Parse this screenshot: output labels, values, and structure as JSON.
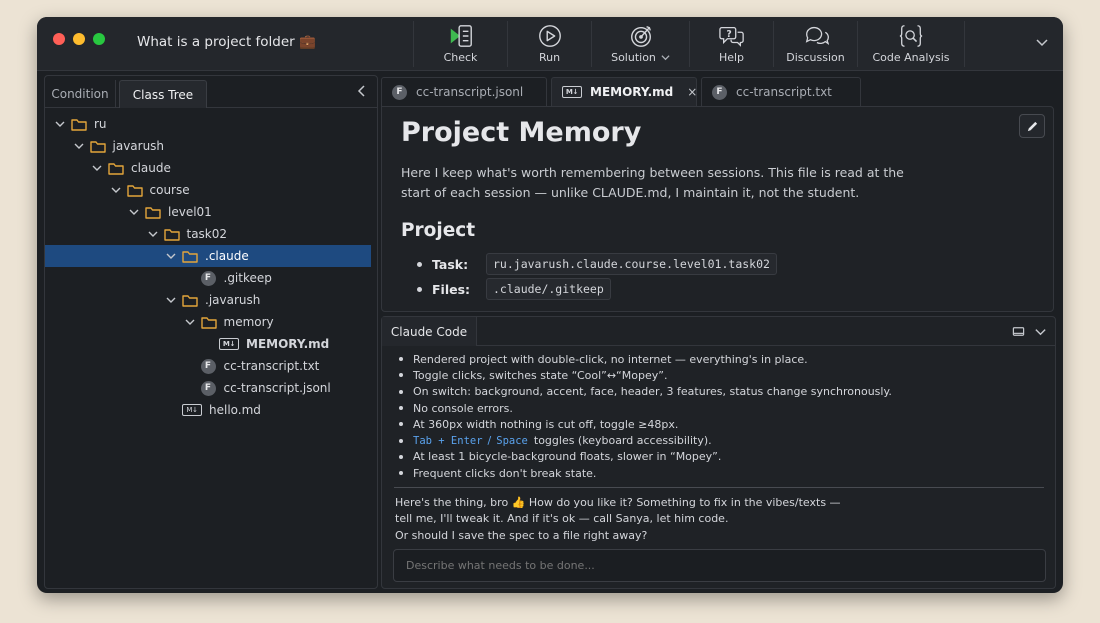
{
  "window": {
    "title": "What is a project folder 💼"
  },
  "toolbar": {
    "items": [
      {
        "label": "Check",
        "icon": "check-icon",
        "accent": "#3fb950"
      },
      {
        "label": "Run",
        "icon": "play-icon"
      },
      {
        "label": "Solution",
        "icon": "target-icon",
        "has_dropdown": true
      },
      {
        "label": "Help",
        "icon": "help-icon"
      },
      {
        "label": "Discussion",
        "icon": "discussion-icon"
      },
      {
        "label": "Code Analysis",
        "icon": "code-analysis-icon"
      }
    ]
  },
  "left_panel": {
    "tabs": [
      "Condition",
      "Class Tree"
    ],
    "active_tab": "Class Tree",
    "tree": [
      {
        "label": "ru",
        "type": "folder",
        "expanded": true
      },
      {
        "label": "javarush",
        "type": "folder",
        "expanded": true
      },
      {
        "label": "claude",
        "type": "folder",
        "expanded": true
      },
      {
        "label": "course",
        "type": "folder",
        "expanded": true
      },
      {
        "label": "level01",
        "type": "folder",
        "expanded": true
      },
      {
        "label": "task02",
        "type": "folder",
        "expanded": true
      },
      {
        "label": ".claude",
        "type": "folder",
        "expanded": true,
        "selected": true
      },
      {
        "label": ".gitkeep",
        "type": "file"
      },
      {
        "label": ".javarush",
        "type": "folder",
        "expanded": true
      },
      {
        "label": "memory",
        "type": "folder",
        "expanded": true
      },
      {
        "label": "MEMORY.md",
        "type": "markdown"
      },
      {
        "label": "cc-transcript.txt",
        "type": "file"
      },
      {
        "label": "cc-transcript.jsonl",
        "type": "file"
      },
      {
        "label": "hello.md",
        "type": "markdown"
      }
    ]
  },
  "editor": {
    "tabs": [
      {
        "label": "cc-transcript.jsonl",
        "type": "file"
      },
      {
        "label": "MEMORY.md",
        "type": "markdown",
        "active": true,
        "close": "×"
      },
      {
        "label": "cc-transcript.txt",
        "type": "file"
      }
    ],
    "md_badge": "M↓",
    "file_badge": "F",
    "document": {
      "title": "Project Memory",
      "intro": "Here I keep what's worth remembering between sessions. This file is read at the start of each session — unlike CLAUDE.md, I maintain it, not the student.",
      "section": "Project",
      "properties": [
        {
          "key": "Task:",
          "value": "ru.javarush.claude.course.level01.task02"
        },
        {
          "key": "Files:",
          "value": ".claude/.gitkeep"
        }
      ]
    }
  },
  "claude_panel": {
    "title": "Claude Code",
    "checklist": [
      "Rendered project with double-click, no internet — everything's in place.",
      "Toggle clicks, switches state “Cool”↔“Mopey”.",
      "On switch: background, accent, face, header, 3 features, status change synchronously.",
      "No console errors.",
      "At 360px width nothing is cut off, toggle ≥48px.",
      "KBD",
      "At least 1 bicycle-background floats, slower in “Mopey”.",
      "Frequent clicks don't break state."
    ],
    "kbd_item": {
      "key1": "Tab + Enter",
      "sep": "/",
      "key2": "Space",
      "text": "toggles (keyboard accessibility)."
    },
    "reply": "Here's the thing, bro 👍 How do you like it? Something to fix in the vibes/texts —\ntell me, I'll tweak it. And if it's ok — call Sanya, let him code.\nOr should I save the spec to a file right away?",
    "input_placeholder": "Describe what needs to be done..."
  }
}
